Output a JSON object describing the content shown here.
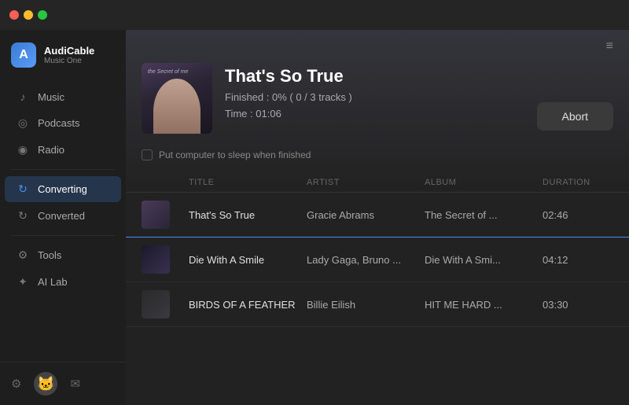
{
  "titlebar": {
    "traffic_lights": [
      "close",
      "minimize",
      "maximize"
    ]
  },
  "sidebar": {
    "logo": {
      "name": "AudiCable",
      "subtitle": "Music One",
      "icon": "A"
    },
    "nav_items": [
      {
        "id": "music",
        "label": "Music",
        "icon": "♪"
      },
      {
        "id": "podcasts",
        "label": "Podcasts",
        "icon": "🎙"
      },
      {
        "id": "radio",
        "label": "Radio",
        "icon": "📻"
      }
    ],
    "convert_items": [
      {
        "id": "converting",
        "label": "Converting",
        "icon": "⟳",
        "active": true
      },
      {
        "id": "converted",
        "label": "Converted",
        "icon": "✓",
        "active": false
      }
    ],
    "tool_items": [
      {
        "id": "tools",
        "label": "Tools",
        "icon": "🔧"
      },
      {
        "id": "ailab",
        "label": "AI Lab",
        "icon": "✦"
      }
    ],
    "bottom": {
      "settings_icon": "⚙",
      "avatar_icon": "🐱",
      "mail_icon": "✉"
    }
  },
  "header": {
    "menu_icon": "≡"
  },
  "info_panel": {
    "track_title": "That's So True",
    "finished_label": "Finished :",
    "finished_value": "0% ( 0 / 3 tracks )",
    "time_label": "Time :",
    "time_value": "01:06"
  },
  "controls": {
    "abort_label": "Abort",
    "sleep_label": "Put computer to sleep when finished"
  },
  "table": {
    "headers": [
      "",
      "TITLE",
      "ARTIST",
      "ALBUM",
      "DURATION"
    ],
    "rows": [
      {
        "thumb_class": "thumb-1",
        "title": "That's So True",
        "artist": "Gracie Abrams",
        "album": "The Secret of ...",
        "duration": "02:46",
        "active": true
      },
      {
        "thumb_class": "thumb-2",
        "title": "Die With A Smile",
        "artist": "Lady Gaga, Bruno ...",
        "album": "Die With A Smi...",
        "duration": "04:12",
        "active": false
      },
      {
        "thumb_class": "thumb-3",
        "title": "BIRDS OF A FEATHER",
        "artist": "Billie Eilish",
        "album": "HIT ME HARD ...",
        "duration": "03:30",
        "active": false
      }
    ]
  }
}
